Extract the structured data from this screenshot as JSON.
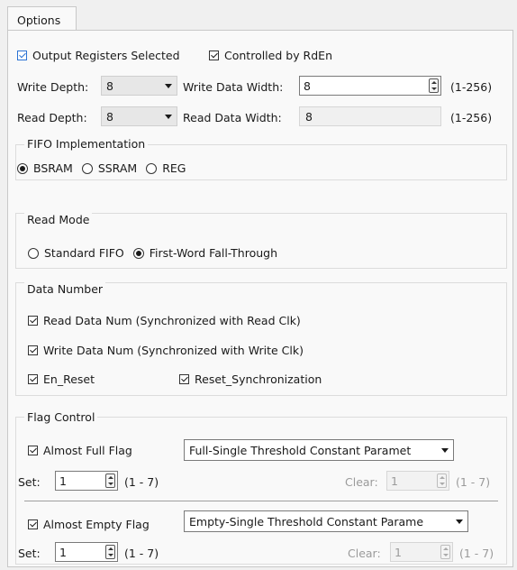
{
  "tab": {
    "label": "Options"
  },
  "top": {
    "output_registers_label": "Output Registers Selected",
    "controlled_by_rden_label": "Controlled by RdEn",
    "write_depth_label": "Write Depth:",
    "write_depth_value": "8",
    "write_data_width_label": "Write Data Width:",
    "write_data_width_value": "8",
    "write_range": "(1-256)",
    "read_depth_label": "Read Depth:",
    "read_depth_value": "8",
    "read_data_width_label": "Read Data Width:",
    "read_data_width_value": "8",
    "read_range": "(1-256)"
  },
  "fifo": {
    "title": "FIFO Implementation",
    "options": [
      "BSRAM",
      "SSRAM",
      "REG"
    ],
    "selected": "BSRAM"
  },
  "read_mode": {
    "title": "Read Mode",
    "options": [
      "Standard FIFO",
      "First-Word Fall-Through"
    ],
    "selected": "First-Word Fall-Through"
  },
  "data_number": {
    "title": "Data Number",
    "read_data_num": "Read Data Num (Synchronized with Read Clk)",
    "write_data_num": "Write Data Num (Synchronized with Write Clk)",
    "en_reset": "En_Reset",
    "reset_sync": "Reset_Synchronization"
  },
  "flag_control": {
    "title": "Flag Control",
    "full": {
      "label": "Almost Full Flag",
      "mode": "Full-Single Threshold Constant Paramet",
      "set_label": "Set:",
      "set_value": "1",
      "set_range": "(1 - 7)",
      "clear_label": "Clear:",
      "clear_value": "1",
      "clear_range": "(1 - 7)"
    },
    "empty": {
      "label": "Almost Empty Flag",
      "mode": "Empty-Single Threshold Constant Parame",
      "set_label": "Set:",
      "set_value": "1",
      "set_range": "(1 - 7)",
      "clear_label": "Clear:",
      "clear_value": "1",
      "clear_range": "(1 - 7)"
    }
  },
  "colors": {
    "accent": "#2a72d4",
    "panel": "#f9f9f9",
    "window": "#f0f0f0"
  }
}
